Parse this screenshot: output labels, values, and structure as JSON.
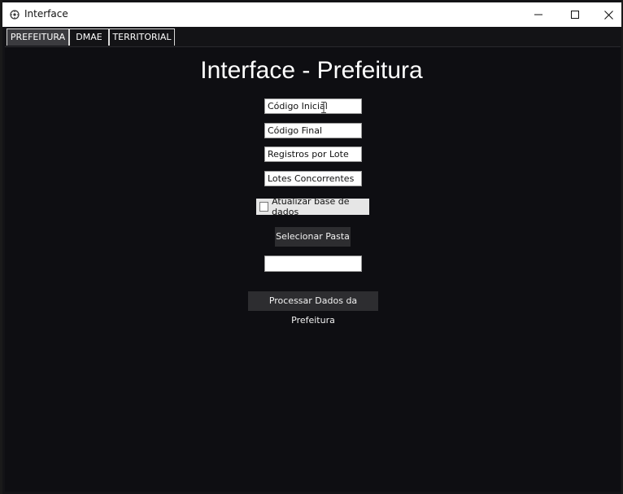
{
  "window": {
    "title": "Interface",
    "controls": {
      "minimize": "minimize-icon",
      "maximize": "maximize-icon",
      "close": "close-icon"
    }
  },
  "tabs": [
    {
      "label": "PREFEITURA",
      "active": true
    },
    {
      "label": "DMAE",
      "active": false
    },
    {
      "label": "TERRITORIAL",
      "active": false
    }
  ],
  "main": {
    "heading": "Interface - Prefeitura",
    "fields": {
      "codigo_inicial": "Código Inicial",
      "codigo_final": "Código Final",
      "registros_por_lote": "Registros por Lote",
      "lotes_concorrentes": "Lotes Concorrentes",
      "pasta": ""
    },
    "checkbox": {
      "label": "Atualizar base de dados",
      "checked": false
    },
    "select_folder_button": "Selecionar Pasta",
    "process_button": "Processar Dados da Prefeitura"
  },
  "colors": {
    "background": "#0e0e12",
    "active_tab": "#3b3b3f",
    "button": "#2d2d30",
    "text": "#ffffff"
  }
}
